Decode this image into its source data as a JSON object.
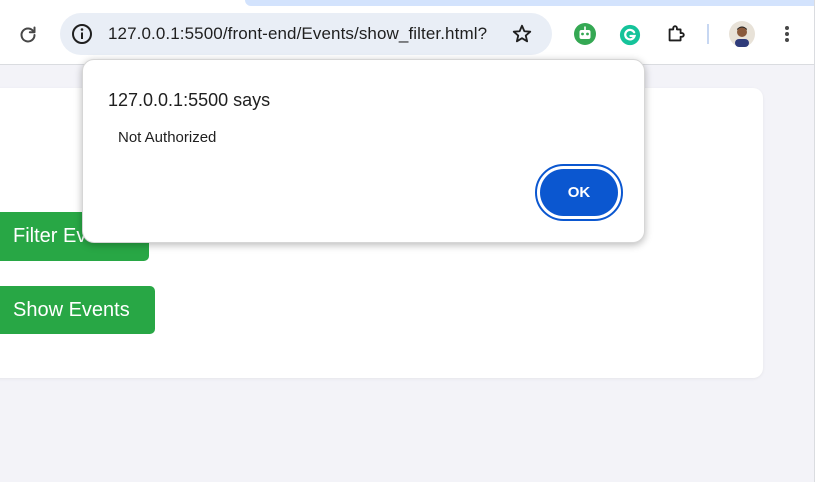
{
  "browser": {
    "address_bar": {
      "url": "127.0.0.1:5500/front-end/Events/show_filter.html?"
    },
    "icons": {
      "reload": "reload-icon",
      "site_info": "site-info-icon",
      "bookmark": "star-icon",
      "extension_robot": "robot-extension-icon",
      "extension_grammarly": "grammarly-icon",
      "extensions": "puzzle-icon",
      "profile": "avatar",
      "menu": "kebab-menu-icon"
    },
    "colors": {
      "omnibox_bg": "#e9eef6",
      "grammarly": "#15c39a",
      "robot": "#34a853"
    }
  },
  "page": {
    "buttons": {
      "filter_events": "Filter Events",
      "show_events": "Show Events"
    },
    "colors": {
      "button_green": "#28a745",
      "background": "#f3f3f8"
    }
  },
  "dialog": {
    "title": "127.0.0.1:5500 says",
    "message": "Not Authorized",
    "ok_label": "OK",
    "colors": {
      "ok_bg": "#0b57d0"
    }
  }
}
